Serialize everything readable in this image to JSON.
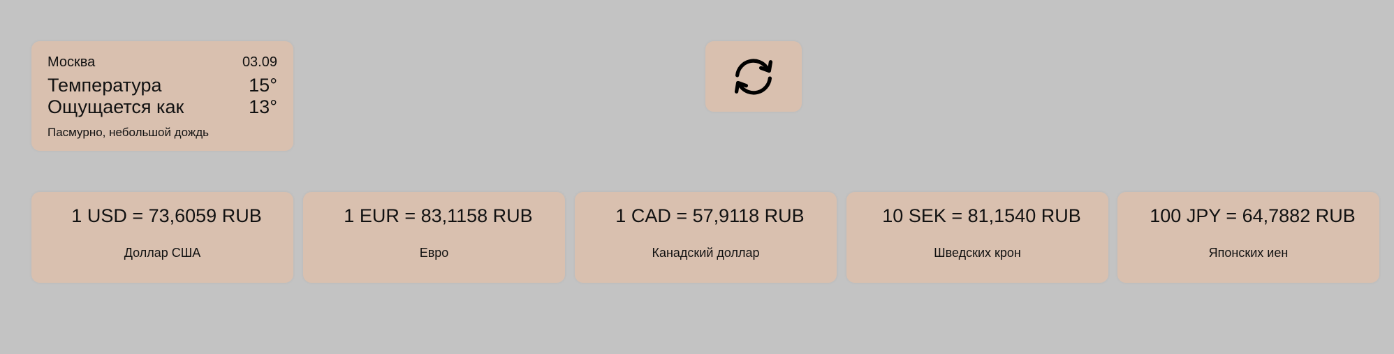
{
  "weather": {
    "city": "Москва",
    "date": "03.09",
    "temp_label": "Температура",
    "temp_value": "15°",
    "feels_label": "Ощущается как",
    "feels_value": "13°",
    "description": "Пасмурно, небольшой дождь"
  },
  "refresh": {
    "icon": "refresh-icon"
  },
  "currencies": [
    {
      "rate": "1 USD = 73,6059 RUB",
      "name": "Доллар США"
    },
    {
      "rate": "1 EUR = 83,1158 RUB",
      "name": "Евро"
    },
    {
      "rate": "1 CAD = 57,9118 RUB",
      "name": "Канадский доллар"
    },
    {
      "rate": "10 SEK = 81,1540 RUB",
      "name": "Шведских крон"
    },
    {
      "rate": "100 JPY = 64,7882 RUB",
      "name": "Японских иен"
    }
  ],
  "colors": {
    "background": "#c3c3c3",
    "card": "#d9c0af",
    "text": "#111111"
  }
}
